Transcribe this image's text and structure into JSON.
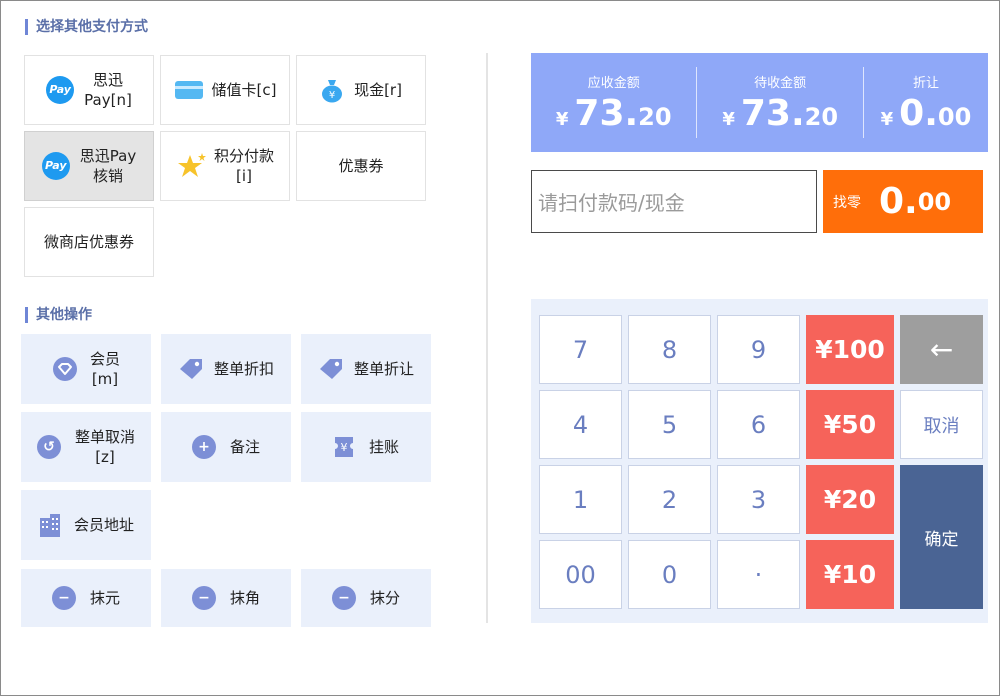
{
  "sections": {
    "payment_title": "选择其他支付方式",
    "ops_title": "其他操作"
  },
  "payment_methods": [
    {
      "label": "思迅\nPay[n]"
    },
    {
      "label": "储值卡[c]"
    },
    {
      "label": "现金[r]"
    },
    {
      "label": "思迅Pay\n核销"
    },
    {
      "label": "积分付款\n[i]"
    },
    {
      "label": "优惠券"
    },
    {
      "label": "微商店优惠券"
    }
  ],
  "pay_icon_text": "Pay",
  "operations": [
    {
      "label": "会员\n[m]"
    },
    {
      "label": "整单折扣"
    },
    {
      "label": "整单折让"
    },
    {
      "label": "整单取消\n[z]"
    },
    {
      "label": "备注"
    },
    {
      "label": "挂账"
    },
    {
      "label": "会员地址"
    },
    {
      "label": "抹元"
    },
    {
      "label": "抹角"
    },
    {
      "label": "抹分"
    }
  ],
  "summary": {
    "currency": "¥",
    "receivable": {
      "label": "应收金额",
      "int": "73.",
      "dec": "20"
    },
    "pending": {
      "label": "待收金额",
      "int": "73.",
      "dec": "20"
    },
    "discount": {
      "label": "折让",
      "int": "0.",
      "dec": "00"
    }
  },
  "input": {
    "placeholder": "请扫付款码/现金"
  },
  "change": {
    "label": "找零",
    "int": "0.",
    "dec": "00"
  },
  "keypad": {
    "k7": "7",
    "k8": "8",
    "k9": "9",
    "k4": "4",
    "k5": "5",
    "k6": "6",
    "k1": "1",
    "k2": "2",
    "k3": "3",
    "k00": "00",
    "k0": "0",
    "kdot": "·",
    "q100": "¥100",
    "q50": "¥50",
    "q20": "¥20",
    "q10": "¥10",
    "backspace": "←",
    "cancel": "取消",
    "confirm": "确定"
  },
  "colors": {
    "accent": "#8fa8f8",
    "change": "#ff6e0a",
    "quick_amount": "#f6635a",
    "confirm": "#4a6494",
    "backspace": "#9e9e9e"
  }
}
